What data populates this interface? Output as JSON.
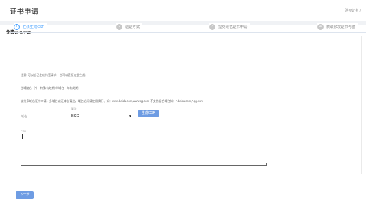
{
  "header": {
    "title": "证书申请",
    "breadcrumb": "购买证书 /"
  },
  "panel": {
    "title": "免费证书申请"
  },
  "steps": [
    {
      "num": "1",
      "label": "在线生成CSR"
    },
    {
      "num": "2",
      "label": "验证方式"
    },
    {
      "num": "3",
      "label": "提交域名证书申请"
    },
    {
      "num": "4",
      "label": "获取颁发证书与密"
    }
  ],
  "notes": {
    "line1": "注意: 可以自己生成待签请求，也可以直接在此生成",
    "line2": "主域脑名（*）：特殊有效期 单域名一年有效期",
    "line3": "支持多域名证书申请，多域名或泛域名请此，域名之间请使用换行、如：www.baidu.com,www.qq.com 不支持混合域名如：*.baidu.com,*.qq.com"
  },
  "form": {
    "domain_placeholder": "域名",
    "algo_label": "算法",
    "algo_value": "ECC",
    "generate_button": "生成CSR",
    "csr_label": "CSR",
    "next_button": "下一步"
  }
}
